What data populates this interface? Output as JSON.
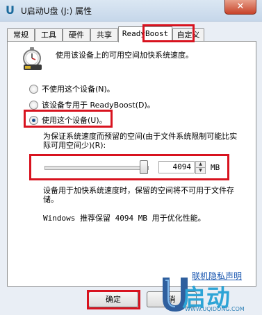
{
  "window": {
    "title": "U启动U盘 (J:) 属性",
    "close_symbol": "✕",
    "app_icon": "usb-drive-icon"
  },
  "tabs": [
    {
      "label": "常规"
    },
    {
      "label": "工具"
    },
    {
      "label": "硬件"
    },
    {
      "label": "共享"
    },
    {
      "label": "ReadyBoost",
      "active": true
    },
    {
      "label": "自定义"
    }
  ],
  "readyboost": {
    "icon": "readyboost-stopwatch-icon",
    "intro": "使用该设备上的可用空间加快系统速度。",
    "options": [
      {
        "label": "不使用这个设备(N)。",
        "selected": false
      },
      {
        "label": "该设备专用于 ReadyBoost(D)。",
        "selected": false
      },
      {
        "label": "使用这个设备(U)。",
        "selected": true
      }
    ],
    "reserve_label": "为保证系统速度而预留的空间(由于文件系统限制可能比实际可用空间少)(R):",
    "slider_fraction": 0.95,
    "space_value": "4094",
    "space_unit": "MB",
    "usage_note": "设备用于加快系统速度时，保留的空间将不可用于文件存储。",
    "recommendation": "Windows 推荐保留 4094 MB 用于优化性能。"
  },
  "footer": {
    "privacy_link": "联机隐私声明",
    "ok_label": "确定",
    "cancel_label": "消"
  },
  "watermark": {
    "brand": "启动",
    "url": "WWW.UQIDONG.COM"
  },
  "colors": {
    "highlight": "#d8131f",
    "title_bar": "#c6d7ea",
    "link": "#1a57b0",
    "brand": "#2da4d6"
  }
}
